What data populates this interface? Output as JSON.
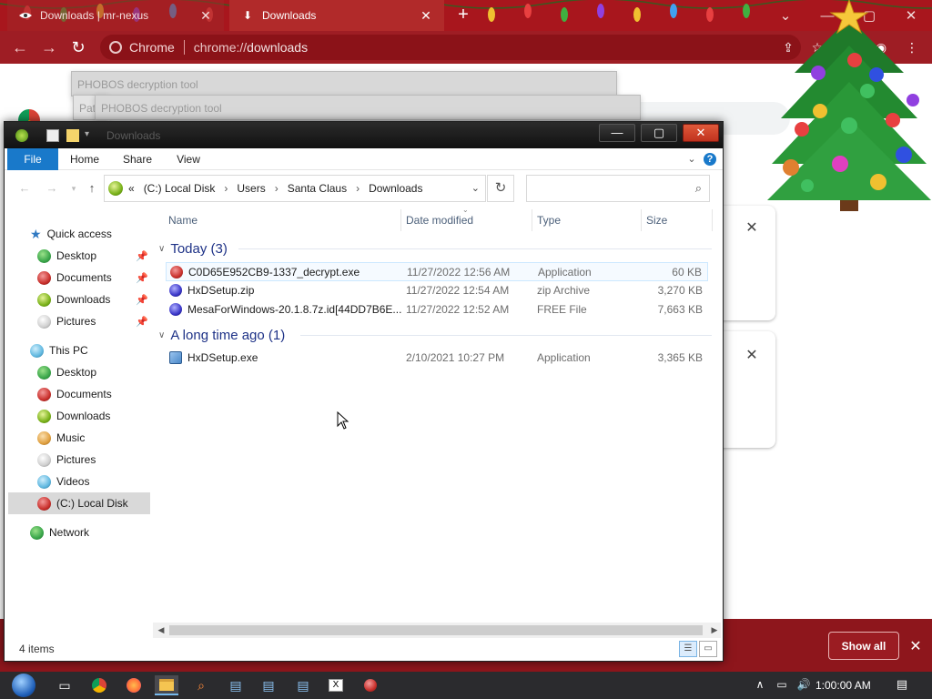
{
  "browser": {
    "tabs": [
      {
        "title": "Downloads | mr-nexus",
        "icon": "nexus-icon",
        "active": false
      },
      {
        "title": "Downloads",
        "icon": "download-icon",
        "active": true
      }
    ],
    "url_chip": "Chrome",
    "url_scheme": "chrome://",
    "url_path": "downloads",
    "download_bar": {
      "show_all_label": "Show all"
    }
  },
  "ghost_windows": [
    {
      "title": "PHOBOS decryption tool"
    },
    {
      "title": "PHOBOS decryption tool"
    },
    {
      "title": "Path"
    }
  ],
  "explorer": {
    "title": "Downloads",
    "ribbon_tabs": [
      "File",
      "Home",
      "Share",
      "View"
    ],
    "breadcrumb": [
      "(C:) Local Disk",
      "Users",
      "Santa Claus",
      "Downloads"
    ],
    "breadcrumb_prefix": "«",
    "nav": {
      "quick_access": {
        "label": "Quick access",
        "items": [
          {
            "label": "Desktop",
            "color": "#3aa64a"
          },
          {
            "label": "Documents",
            "color": "#c9302c"
          },
          {
            "label": "Downloads",
            "color": "#7ab21a"
          },
          {
            "label": "Pictures",
            "color": "#e8e8e8"
          }
        ]
      },
      "this_pc": {
        "label": "This PC",
        "items": [
          {
            "label": "Desktop",
            "color": "#3aa64a"
          },
          {
            "label": "Documents",
            "color": "#c9302c"
          },
          {
            "label": "Downloads",
            "color": "#7ab21a"
          },
          {
            "label": "Music",
            "color": "#e0a040"
          },
          {
            "label": "Pictures",
            "color": "#e8e8e8"
          },
          {
            "label": "Videos",
            "color": "#60b8e0"
          },
          {
            "label": "(C:) Local Disk",
            "color": "#c9302c"
          }
        ]
      },
      "network": {
        "label": "Network"
      }
    },
    "columns": {
      "name": "Name",
      "date": "Date modified",
      "type": "Type",
      "size": "Size"
    },
    "groups": [
      {
        "label": "Today (3)",
        "files": [
          {
            "name": "C0D65E952CB9-1337_decrypt.exe",
            "date": "11/27/2022 12:56 AM",
            "type": "Application",
            "size": "60 KB",
            "icon_color": "#c9302c"
          },
          {
            "name": "HxDSetup.zip",
            "date": "11/27/2022 12:54 AM",
            "type": "zip Archive",
            "size": "3,270 KB",
            "icon_color": "#3a36c8"
          },
          {
            "name": "MesaForWindows-20.1.8.7z.id[44DD7B6E...",
            "date": "11/27/2022 12:52 AM",
            "type": "FREE File",
            "size": "7,663 KB",
            "icon_color": "#3a36c8"
          }
        ]
      },
      {
        "label": "A long time ago (1)",
        "files": [
          {
            "name": "HxDSetup.exe",
            "date": "2/10/2021 10:27 PM",
            "type": "Application",
            "size": "3,365 KB",
            "icon_color": "#4a88c8"
          }
        ]
      }
    ],
    "status": "4 items"
  },
  "taskbar": {
    "clock": "1:00:00 AM",
    "apps": [
      "start-orb-icon",
      "task-view-icon",
      "chrome-icon",
      "firefox-icon",
      "file-explorer-icon",
      "search-icon",
      "hxd-icon",
      "hxd-icon",
      "hxd-icon",
      "excel-icon",
      "ransom-app-icon"
    ]
  }
}
